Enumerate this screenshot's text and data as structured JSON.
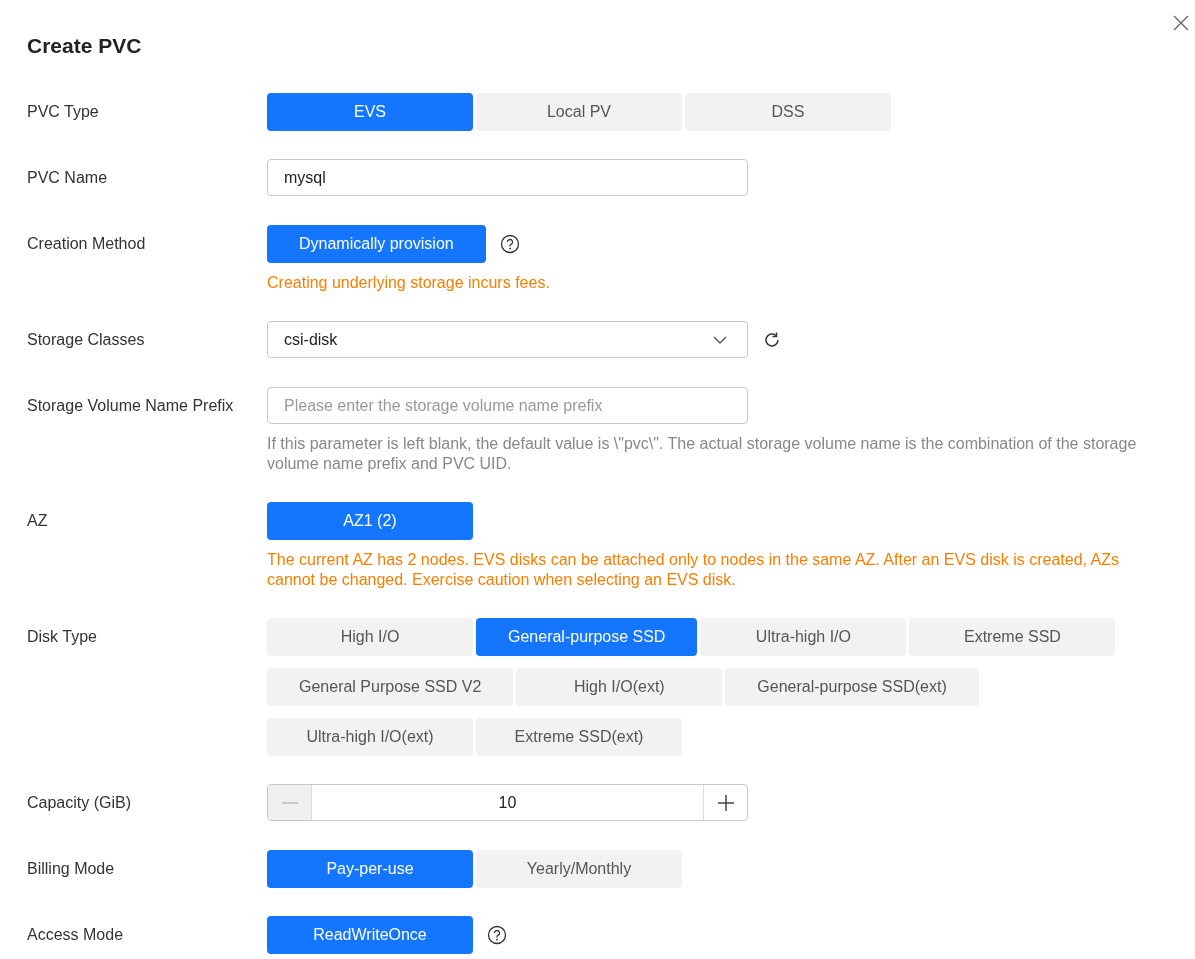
{
  "title": "Create PVC",
  "fields": [
    {
      "label": "PVC Type",
      "kind": "segmented",
      "options": [
        {
          "label": "EVS",
          "selected": true
        },
        {
          "label": "Local PV",
          "selected": false
        },
        {
          "label": "DSS",
          "selected": false
        }
      ]
    },
    {
      "label": "PVC Name",
      "kind": "input",
      "value": "mysql"
    },
    {
      "label": "Creation Method",
      "kind": "segmented",
      "help": true,
      "options": [
        {
          "label": "Dynamically provision",
          "selected": true
        }
      ],
      "hint": {
        "kind": "warning",
        "text": "Creating underlying storage incurs fees."
      }
    },
    {
      "label": "Storage Classes",
      "kind": "select",
      "value": "csi-disk",
      "refresh": true
    },
    {
      "label": "Storage Volume Name Prefix",
      "kind": "input",
      "placeholder": "Please enter the storage volume name prefix",
      "hint": {
        "kind": "info",
        "text": "If this parameter is left blank, the default value is \\\"pvc\\\". The actual storage volume name is the combination of the storage volume name prefix and PVC UID."
      }
    },
    {
      "label": "AZ",
      "kind": "segmented",
      "options": [
        {
          "label": "AZ1 (2)",
          "selected": true
        }
      ],
      "hint": {
        "kind": "warning",
        "text": "The current AZ has 2 nodes. EVS disks can be attached only to nodes in the same AZ. After an EVS disk is created, AZs cannot be changed. Exercise caution when selecting an EVS disk."
      }
    },
    {
      "label": "Disk Type",
      "kind": "segmented",
      "options": [
        {
          "label": "High I/O",
          "selected": false
        },
        {
          "label": "General-purpose SSD",
          "selected": true
        },
        {
          "label": "Ultra-high I/O",
          "selected": false
        },
        {
          "label": "Extreme SSD",
          "selected": false
        },
        {
          "label": "General Purpose SSD V2",
          "selected": false
        },
        {
          "label": "High I/O(ext)",
          "selected": false
        },
        {
          "label": "General-purpose SSD(ext)",
          "selected": false
        },
        {
          "label": "Ultra-high I/O(ext)",
          "selected": false
        },
        {
          "label": "Extreme SSD(ext)",
          "selected": false
        }
      ]
    },
    {
      "label": "Capacity (GiB)",
      "kind": "number",
      "value": "10",
      "minus_disabled": true
    },
    {
      "label": "Billing Mode",
      "kind": "segmented",
      "options": [
        {
          "label": "Pay-per-use",
          "selected": true
        },
        {
          "label": "Yearly/Monthly",
          "selected": false
        }
      ]
    },
    {
      "label": "Access Mode",
      "kind": "segmented",
      "help": true,
      "options": [
        {
          "label": "ReadWriteOnce",
          "selected": true
        }
      ]
    }
  ]
}
